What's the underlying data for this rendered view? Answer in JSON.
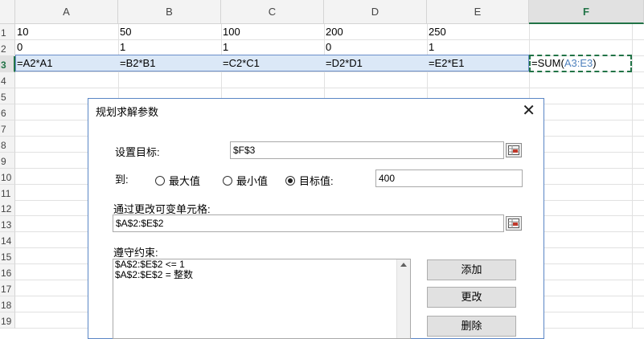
{
  "columns": [
    "A",
    "B",
    "C",
    "D",
    "E",
    "F"
  ],
  "rows": [
    "1",
    "2",
    "3",
    "4",
    "5",
    "6",
    "7",
    "8",
    "9",
    "10",
    "11",
    "12",
    "13",
    "14",
    "15",
    "16",
    "17",
    "18",
    "19"
  ],
  "cells": {
    "row1": [
      "10",
      "50",
      "100",
      "200",
      "250"
    ],
    "row2": [
      "0",
      "1",
      "1",
      "0",
      "1"
    ],
    "row3": [
      "=A2*A1",
      "=B2*B1",
      "=C2*C1",
      "=D2*D1",
      "=E2*E1"
    ],
    "f3_prefix": "=SUM(",
    "f3_ref": "A3:E3",
    "f3_suffix": ")"
  },
  "dialog": {
    "title": "规划求解参数",
    "set_objective_label": "设置目标:",
    "set_objective_value": "$F$3",
    "to_label": "到:",
    "options": [
      "最大值",
      "最小值",
      "目标值:"
    ],
    "selected_option": "目标值:",
    "target_value": "400",
    "changing_cells_label": "通过更改可变单元格:",
    "changing_cells_value": "$A$2:$E$2",
    "constraints_label": "遵守约束:",
    "constraints": [
      "$A$2:$E$2 <= 1",
      "$A$2:$E$2 = 整数"
    ],
    "buttons": {
      "add": "添加",
      "change": "更改",
      "delete": "删除"
    }
  }
}
